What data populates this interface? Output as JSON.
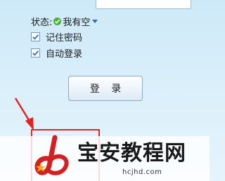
{
  "login_form": {
    "status_label": "状态:",
    "status_value": "我有空",
    "remember_password_label": "记住密码",
    "auto_login_label": "自动登录",
    "login_button_label": "登 录"
  },
  "watermark": {
    "title": "宝安教程网",
    "url": "hcjhd.com"
  },
  "colors": {
    "background": "#d6eef9",
    "status_online": "#4caf3a",
    "checkmark": "#3a7bd5",
    "highlight": "#e52322"
  }
}
